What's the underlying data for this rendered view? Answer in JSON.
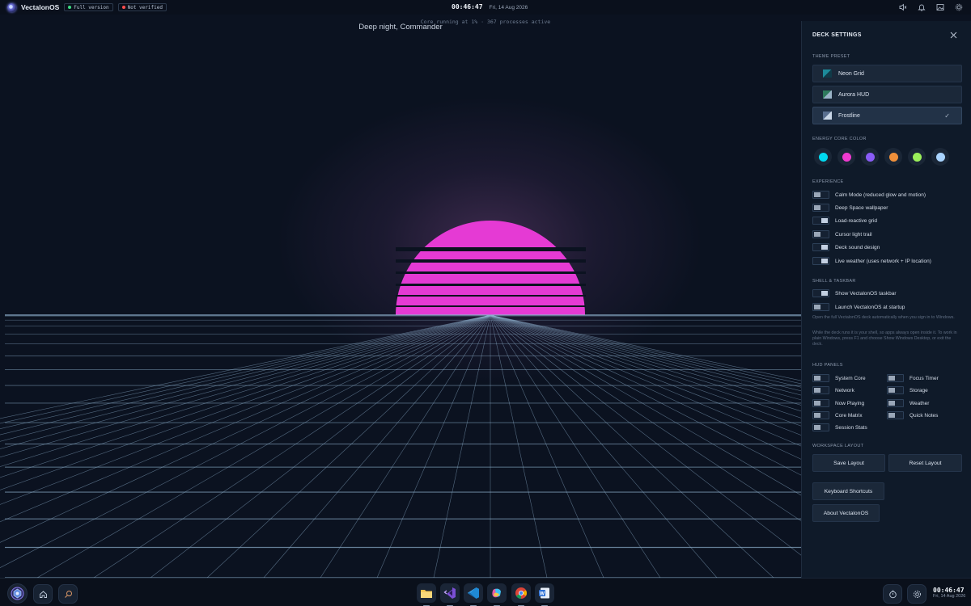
{
  "topbar": {
    "app_title": "VectalonOS",
    "badges": [
      {
        "label": "Full version",
        "color": "#3ddc84"
      },
      {
        "label": "Not verified",
        "color": "#ff4d4d"
      }
    ],
    "time": "00:46:47",
    "date": "Fri, 14 Aug 2026",
    "icons": [
      "volume-icon",
      "bell-icon",
      "image-icon",
      "settings-icon"
    ]
  },
  "scene": {
    "greeting": "Deep night, Commander",
    "status": "Core running at 1% · 367 processes active",
    "sun_color": "#e53ad4",
    "grid_color": "#8fb3cf"
  },
  "panel": {
    "title": "DECK SETTINGS",
    "sections": {
      "theme": "THEME PRESET",
      "energy": "ENERGY CORE COLOR",
      "experience": "EXPERIENCE",
      "shell": "SHELL & TASKBAR",
      "hud": "HUD PANELS",
      "workspace": "WORKSPACE LAYOUT"
    },
    "themes": [
      {
        "label": "Neon Grid",
        "selected": false
      },
      {
        "label": "Aurora HUD",
        "selected": false
      },
      {
        "label": "Frostline",
        "selected": true
      }
    ],
    "energy_colors": [
      "#00d9f0",
      "#f03ad0",
      "#8a5cf6",
      "#f0903a",
      "#9bf05a",
      "#a9d4ff"
    ],
    "experience": [
      {
        "label": "Calm Mode (reduced glow and motion)",
        "on": false
      },
      {
        "label": "Deep Space wallpaper",
        "on": false
      },
      {
        "label": "Load-reactive grid",
        "on": true
      },
      {
        "label": "Cursor light trail",
        "on": false
      },
      {
        "label": "Deck sound design",
        "on": true
      },
      {
        "label": "Live weather (uses network + IP location)",
        "on": true
      }
    ],
    "shell": [
      {
        "label": "Show VectalonOS taskbar",
        "on": true
      },
      {
        "label": "Launch VectalonOS at startup",
        "on": false
      }
    ],
    "shell_desc_1": "Open the full VectalonOS deck automatically when you sign in to Windows.",
    "shell_desc_2": "While the deck runs it is your shell, so apps always open inside it. To work in plain Windows, press F1 and choose Show Windows Desktop, or exit the deck.",
    "hud_left": [
      {
        "label": "System Core",
        "on": false
      },
      {
        "label": "Network",
        "on": false
      },
      {
        "label": "Now Playing",
        "on": false
      },
      {
        "label": "Core Matrix",
        "on": false
      },
      {
        "label": "Session Stats",
        "on": false
      }
    ],
    "hud_right": [
      {
        "label": "Focus Timer",
        "on": false
      },
      {
        "label": "Storage",
        "on": false
      },
      {
        "label": "Weather",
        "on": false
      },
      {
        "label": "Quick Notes",
        "on": false
      }
    ],
    "save_layout": "Save Layout",
    "reset_layout": "Reset Layout",
    "keyboard_shortcuts": "Keyboard Shortcuts",
    "about": "About VectalonOS"
  },
  "taskbar": {
    "time": "00:46:47",
    "date": "Fri, 14 Aug 2026",
    "apps": [
      "folder-icon",
      "visual-studio-icon",
      "vscode-icon",
      "copilot-icon",
      "chrome-icon",
      "word-icon"
    ]
  }
}
